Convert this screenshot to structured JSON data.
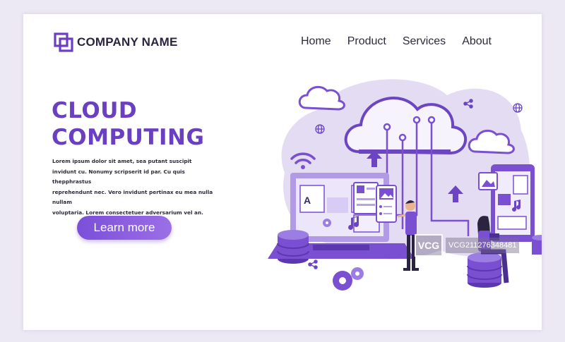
{
  "brand": {
    "name": "COMPANY NAME",
    "color": "#6a3fc2"
  },
  "nav": {
    "items": [
      "Home",
      "Product",
      "Services",
      "About"
    ]
  },
  "hero": {
    "title_line1": "CLOUD",
    "title_line2": "COMPUTING",
    "paragraph_lines": [
      "Lorem ipsum dolor sit amet, sea putant suscipit",
      "invidunt cu. Nonumy scripserit id par. Cu quis thepphrastus",
      "reprehendunt nec. Vero invidunt pertinax eu mea nulla nullam",
      "voluptaria. Lorem consectetuer adversarium vel an."
    ],
    "cta_label": "Learn more"
  },
  "illustration": {
    "icons": [
      "cloud-icon",
      "wifi-icon",
      "laptop-icon",
      "phone-icon",
      "server-icon",
      "gear-icon",
      "share-icon",
      "globe-icon",
      "music-icon",
      "image-icon",
      "document-icon",
      "upload-arrow-icon"
    ],
    "colors": {
      "blob": "#e4dcf3",
      "cloud": "#f3f0fa",
      "primary": "#7a4fd1",
      "dark": "#4a2e91",
      "light": "#b9a3e8"
    }
  },
  "watermark": {
    "badge": "VCG",
    "text": "VCG211276348481"
  }
}
